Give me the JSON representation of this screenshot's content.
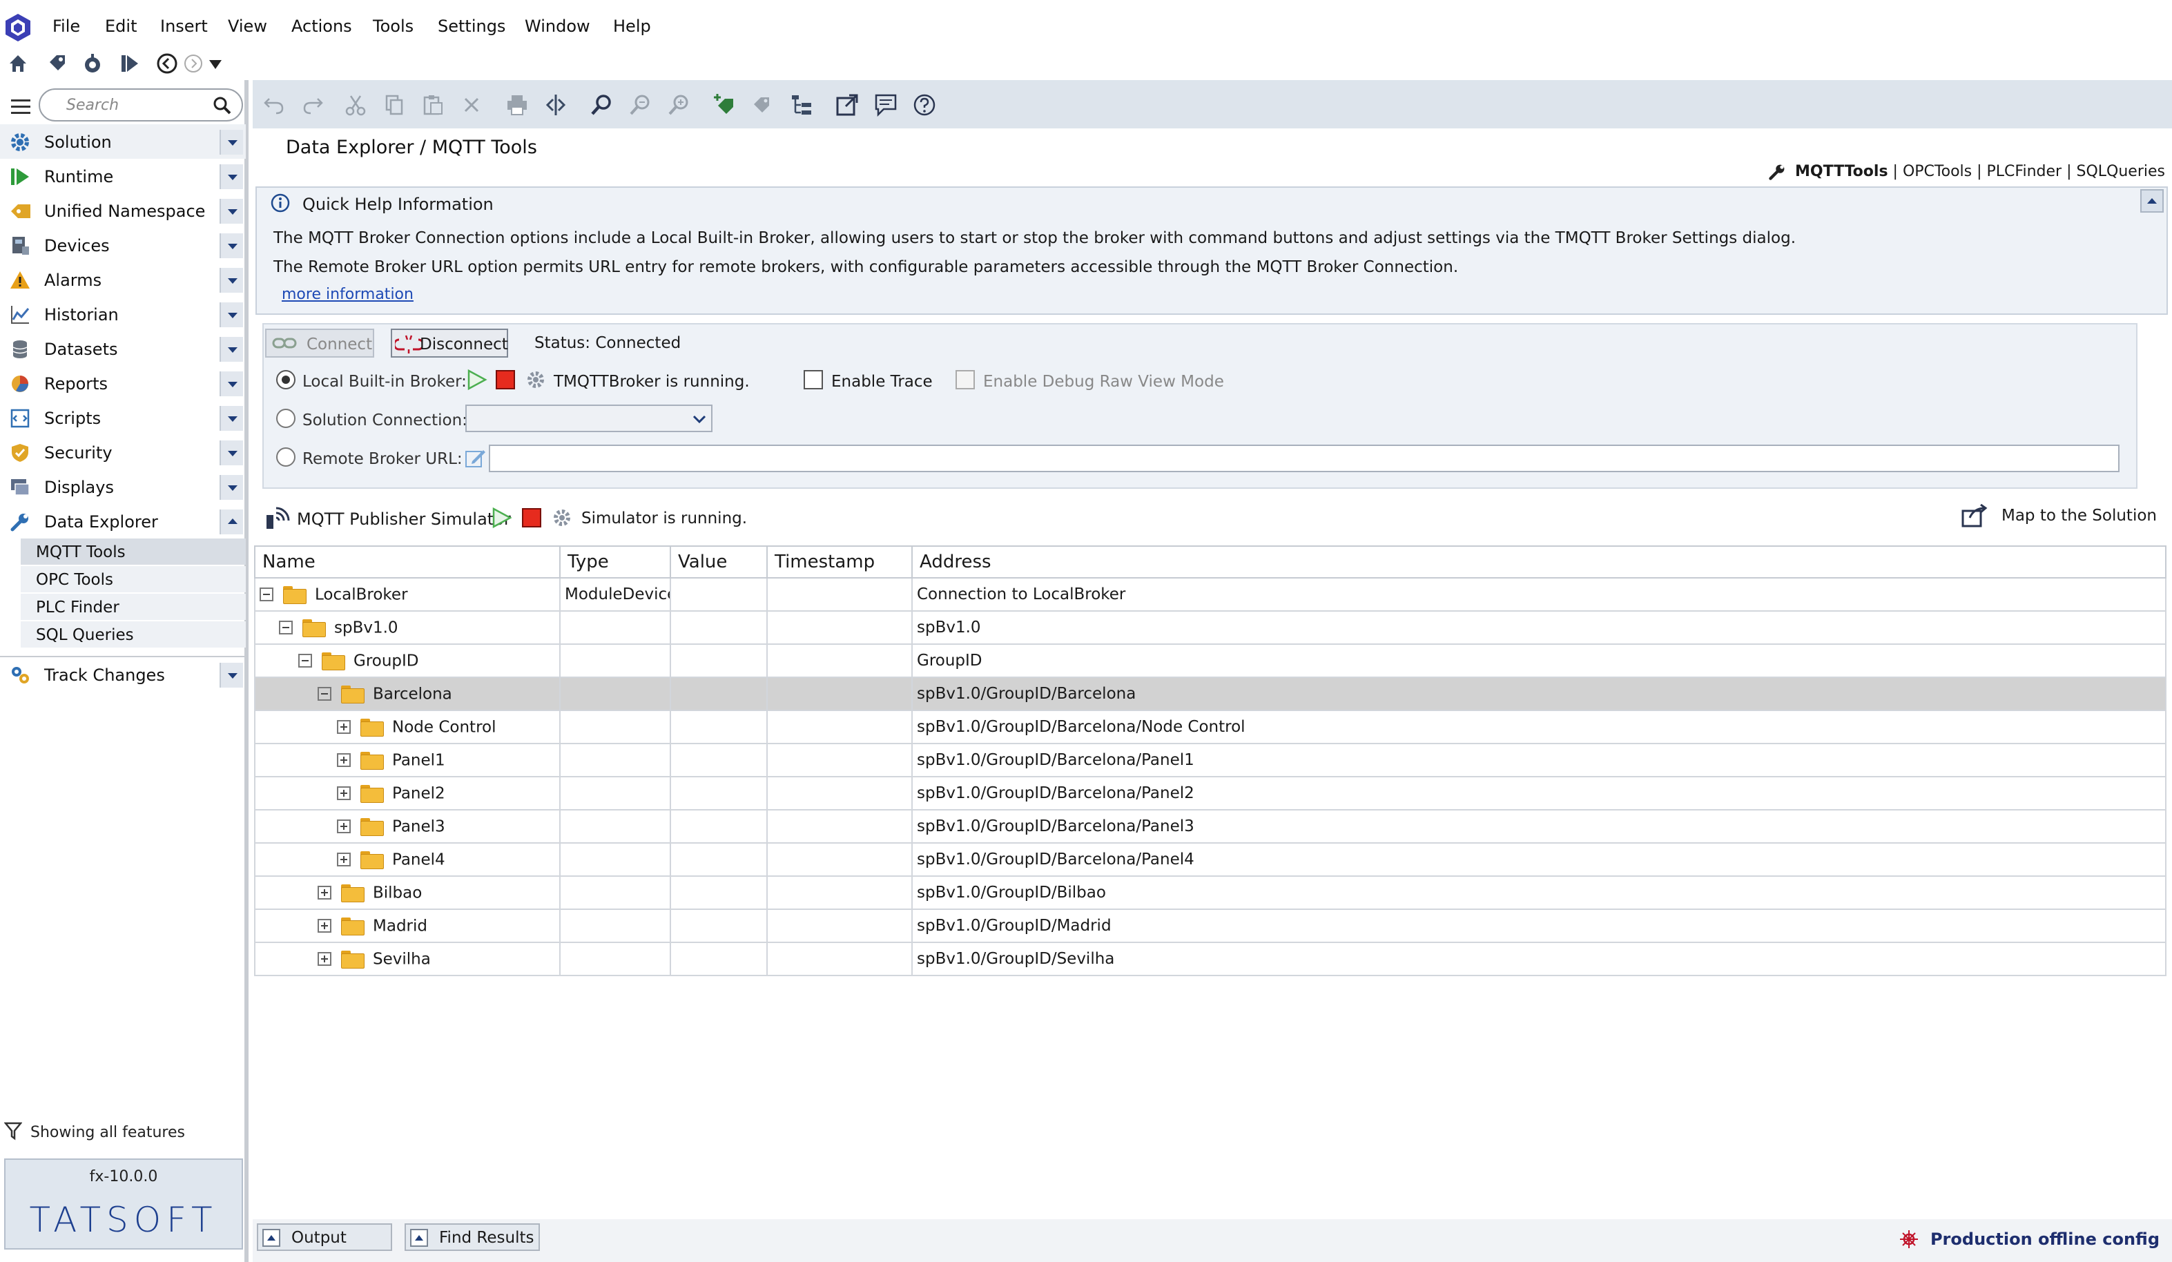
{
  "menu": [
    "File",
    "Edit",
    "Insert",
    "View",
    "Actions",
    "Tools",
    "Settings",
    "Window",
    "Help"
  ],
  "search": {
    "placeholder": "Search"
  },
  "sidebar": {
    "items": [
      {
        "label": "Solution",
        "icon": "gear-icon",
        "color": "#2f6fb3"
      },
      {
        "label": "Runtime",
        "icon": "play-icon",
        "color": "#2e9b3a"
      },
      {
        "label": "Unified Namespace",
        "icon": "tag-icon",
        "color": "#e0a526"
      },
      {
        "label": "Devices",
        "icon": "device-icon",
        "color": "#556070"
      },
      {
        "label": "Alarms",
        "icon": "warning-icon",
        "color": "#e8a018"
      },
      {
        "label": "Historian",
        "icon": "chart-icon",
        "color": "#3c6fb5"
      },
      {
        "label": "Datasets",
        "icon": "database-icon",
        "color": "#6a7480"
      },
      {
        "label": "Reports",
        "icon": "pie-icon",
        "color": "#d0452d"
      },
      {
        "label": "Scripts",
        "icon": "script-icon",
        "color": "#2f6fb3"
      },
      {
        "label": "Security",
        "icon": "shield-icon",
        "color": "#e0a526"
      },
      {
        "label": "Displays",
        "icon": "display-icon",
        "color": "#5a6a86"
      },
      {
        "label": "Data Explorer",
        "icon": "wrench-icon",
        "color": "#2f6fb3"
      }
    ],
    "sub_items": [
      "MQTT Tools",
      "OPC Tools",
      "PLC Finder",
      "SQL Queries"
    ],
    "track_changes": "Track Changes",
    "filter_text": "Showing all features",
    "version": "fx-10.0.0",
    "logo": "TATSOFT"
  },
  "main": {
    "breadcrumb": "Data Explorer / MQTT Tools",
    "tool_links": {
      "active": "MQTTTools",
      "others": [
        "OPCTools",
        "PLCFinder",
        "SQLQueries"
      ],
      "separator": "|"
    },
    "quick_help": {
      "title": "Quick Help Information",
      "line1": "The MQTT Broker Connection options include a Local Built-in Broker, allowing users to start or stop the broker with command buttons and adjust settings via the TMQTT Broker Settings dialog.",
      "line2": "The Remote Broker URL option permits URL entry for remote brokers, with configurable parameters accessible through the MQTT Broker Connection.",
      "more": "more information"
    },
    "connection": {
      "connect_label": "Connect",
      "disconnect_label": "Disconnect",
      "status": "Status: Connected",
      "local_broker_label": "Local Built-in Broker:",
      "local_broker_status": "TMQTTBroker is running.",
      "enable_trace": "Enable Trace",
      "enable_debug": "Enable Debug Raw View Mode",
      "solution_connection_label": "Solution Connection:",
      "solution_connection_value": "",
      "remote_broker_label": "Remote Broker URL:",
      "remote_broker_value": ""
    },
    "simulator": {
      "label": "MQTT Publisher Simulator",
      "status": "Simulator is running.",
      "map_label": "Map to the Solution"
    },
    "table": {
      "columns": [
        "Name",
        "Type",
        "Value",
        "Timestamp",
        "Address"
      ],
      "rows": [
        {
          "level": 0,
          "exp": "minus",
          "name": "LocalBroker",
          "type": "ModuleDevice",
          "value": "",
          "timestamp": "",
          "address": "Connection to LocalBroker"
        },
        {
          "level": 1,
          "exp": "minus",
          "name": "spBv1.0",
          "type": "",
          "value": "",
          "timestamp": "",
          "address": "spBv1.0"
        },
        {
          "level": 2,
          "exp": "minus",
          "name": "GroupID",
          "type": "",
          "value": "",
          "timestamp": "",
          "address": "GroupID"
        },
        {
          "level": 3,
          "exp": "minus",
          "name": "Barcelona",
          "type": "",
          "value": "",
          "timestamp": "",
          "address": "spBv1.0/GroupID/Barcelona",
          "selected": true
        },
        {
          "level": 4,
          "exp": "plus",
          "name": "Node Control",
          "type": "",
          "value": "",
          "timestamp": "",
          "address": "spBv1.0/GroupID/Barcelona/Node Control"
        },
        {
          "level": 4,
          "exp": "plus",
          "name": "Panel1",
          "type": "",
          "value": "",
          "timestamp": "",
          "address": "spBv1.0/GroupID/Barcelona/Panel1"
        },
        {
          "level": 4,
          "exp": "plus",
          "name": "Panel2",
          "type": "",
          "value": "",
          "timestamp": "",
          "address": "spBv1.0/GroupID/Barcelona/Panel2"
        },
        {
          "level": 4,
          "exp": "plus",
          "name": "Panel3",
          "type": "",
          "value": "",
          "timestamp": "",
          "address": "spBv1.0/GroupID/Barcelona/Panel3"
        },
        {
          "level": 4,
          "exp": "plus",
          "name": "Panel4",
          "type": "",
          "value": "",
          "timestamp": "",
          "address": "spBv1.0/GroupID/Barcelona/Panel4"
        },
        {
          "level": 3,
          "exp": "plus",
          "name": "Bilbao",
          "type": "",
          "value": "",
          "timestamp": "",
          "address": "spBv1.0/GroupID/Bilbao"
        },
        {
          "level": 3,
          "exp": "plus",
          "name": "Madrid",
          "type": "",
          "value": "",
          "timestamp": "",
          "address": "spBv1.0/GroupID/Madrid"
        },
        {
          "level": 3,
          "exp": "plus",
          "name": "Sevilha",
          "type": "",
          "value": "",
          "timestamp": "",
          "address": "spBv1.0/GroupID/Sevilha"
        }
      ]
    }
  },
  "bottom": {
    "output_label": "Output",
    "find_label": "Find Results",
    "status_text": "Production offline config"
  },
  "colors": {
    "accent": "#2f6fb3",
    "toolbar_bg": "#dde4ec",
    "selected_row": "#d2d2d2",
    "status_red": "#c0142a"
  }
}
